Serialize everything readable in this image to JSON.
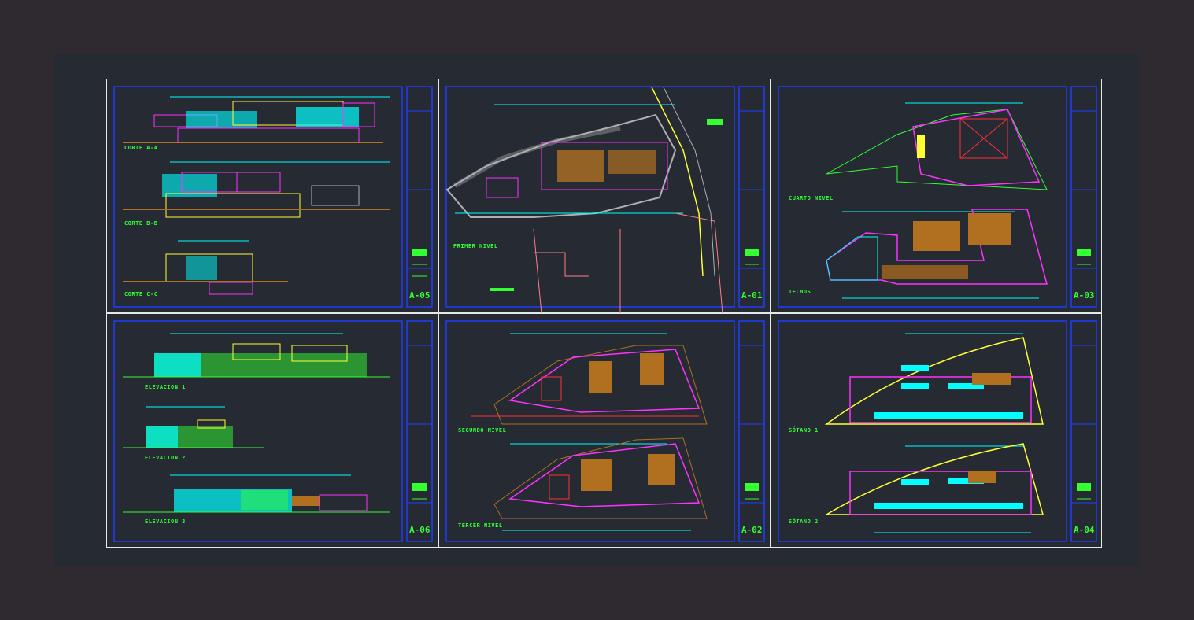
{
  "sheets": [
    {
      "number": "A-05",
      "labels": [
        "CORTE A-A",
        "CORTE B-B",
        "CORTE C-C"
      ]
    },
    {
      "number": "A-01",
      "labels": [
        "PRIMER NIVEL"
      ]
    },
    {
      "number": "A-03",
      "labels": [
        "CUARTO NIVEL",
        "TECHOS"
      ]
    },
    {
      "number": "A-06",
      "labels": [
        "ELEVACION 1",
        "ELEVACION 2",
        "ELEVACION 3"
      ]
    },
    {
      "number": "A-02",
      "labels": [
        "SEGUNDO NIVEL",
        "TERCER NIVEL"
      ]
    },
    {
      "number": "A-04",
      "labels": [
        "SÓTANO 1",
        "SÓTANO 2"
      ]
    }
  ],
  "colors": {
    "background": "#2e2a30",
    "canvas": "#252a33",
    "border": "#e8e8e8",
    "frame": "#1e3cff",
    "label": "#33ff33",
    "cyan": "#00ffff",
    "magenta": "#ff33ff",
    "yellow": "#ffff33",
    "brown": "#b07020",
    "red": "#ff3333",
    "pink": "#ff7f7f",
    "gray": "#b0b0b0"
  }
}
